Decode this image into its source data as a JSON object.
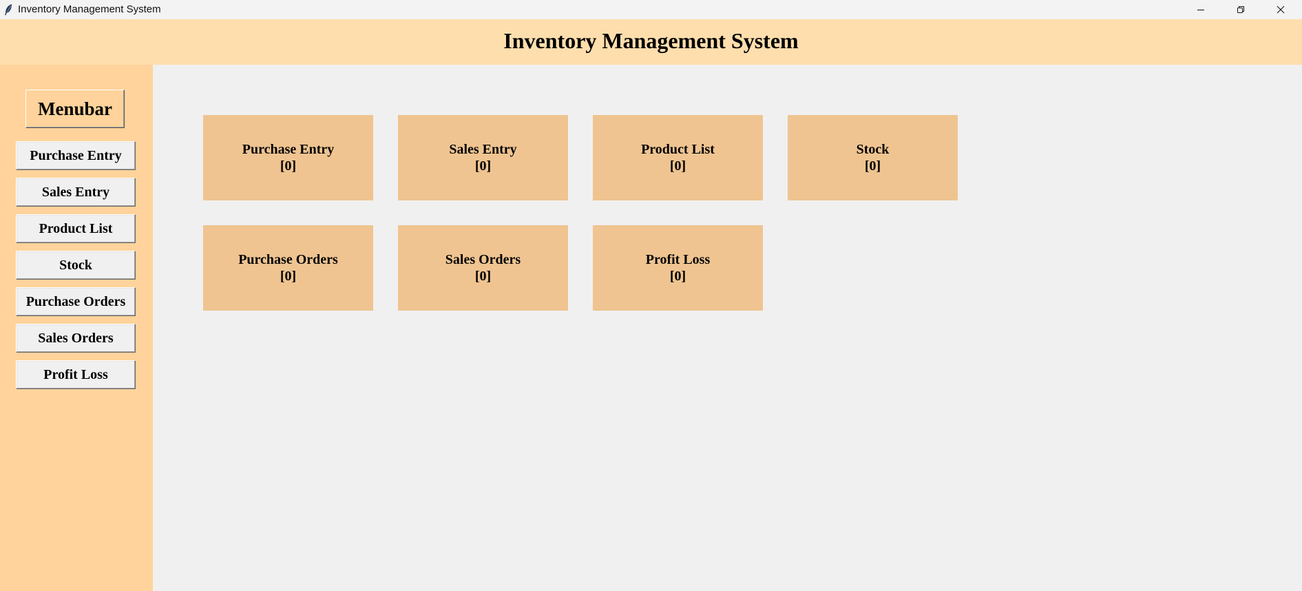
{
  "window": {
    "title": "Inventory Management System",
    "icon": "feather-icon"
  },
  "header": {
    "title": "Inventory Management System"
  },
  "sidebar": {
    "heading": "Menubar",
    "items": [
      {
        "label": "Purchase Entry"
      },
      {
        "label": "Sales Entry"
      },
      {
        "label": "Product List"
      },
      {
        "label": "Stock"
      },
      {
        "label": "Purchase Orders"
      },
      {
        "label": "Sales Orders"
      },
      {
        "label": "Profit Loss"
      }
    ]
  },
  "dashboard": {
    "cards": [
      {
        "label": "Purchase Entry",
        "count": "[0]"
      },
      {
        "label": "Sales Entry",
        "count": "[0]"
      },
      {
        "label": "Product List",
        "count": "[0]"
      },
      {
        "label": "Stock",
        "count": "[0]"
      },
      {
        "label": "Purchase Orders",
        "count": "[0]"
      },
      {
        "label": "Sales Orders",
        "count": "[0]"
      },
      {
        "label": "Profit Loss",
        "count": "[0]"
      }
    ]
  },
  "colors": {
    "header_bg": "#ffdead",
    "sidebar_bg": "#ffd39b",
    "card_bg": "#efc491",
    "main_bg": "#f0f0f0"
  }
}
